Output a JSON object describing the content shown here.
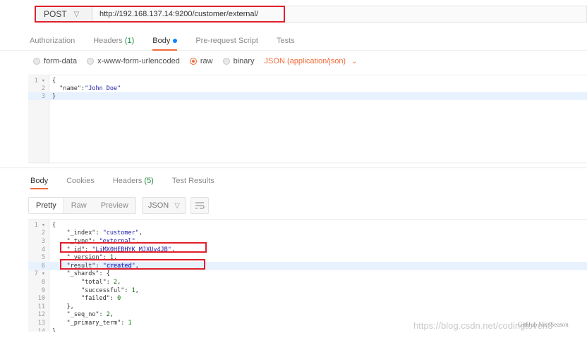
{
  "request": {
    "method": "POST",
    "url": "http://192.168.137.14:9200/customer/external/"
  },
  "request_tabs": [
    {
      "label": "Authorization"
    },
    {
      "label": "Headers",
      "count": "(1)"
    },
    {
      "label": "Body"
    },
    {
      "label": "Pre-request Script"
    },
    {
      "label": "Tests"
    }
  ],
  "body_modes": {
    "form_data": "form-data",
    "urlencoded": "x-www-form-urlencoded",
    "raw": "raw",
    "binary": "binary",
    "content_type": "JSON (application/json)"
  },
  "request_body": {
    "lines": [
      {
        "n": "1 ▾",
        "text": "{"
      },
      {
        "n": "2",
        "text": "  \"name\":\"John Doe\""
      },
      {
        "n": "3",
        "text": "}"
      }
    ]
  },
  "response_tabs": [
    {
      "label": "Body"
    },
    {
      "label": "Cookies"
    },
    {
      "label": "Headers",
      "count": "(5)"
    },
    {
      "label": "Test Results"
    }
  ],
  "response_toolbar": {
    "pretty": "Pretty",
    "raw": "Raw",
    "preview": "Preview",
    "format": "JSON"
  },
  "response_body": {
    "lines": [
      {
        "n": "1 ▾",
        "text": "{"
      },
      {
        "n": "2",
        "text": "    \"_index\": \"customer\","
      },
      {
        "n": "3",
        "text": "    \"_type\": \"external\","
      },
      {
        "n": "4",
        "text": "    \"_id\": \"LiMX0HEBHYK_MJXUv4JB\","
      },
      {
        "n": "5",
        "text": "    \"_version\": 1,"
      },
      {
        "n": "6",
        "text": "    \"result\": \"created\","
      },
      {
        "n": "7 ▾",
        "text": "    \"_shards\": {"
      },
      {
        "n": "8",
        "text": "        \"total\": 2,"
      },
      {
        "n": "9",
        "text": "        \"successful\": 1,"
      },
      {
        "n": "10",
        "text": "        \"failed\": 0"
      },
      {
        "n": "11",
        "text": "    },"
      },
      {
        "n": "12",
        "text": "    \"_seq_no\": 2,"
      },
      {
        "n": "13",
        "text": "    \"_primary_term\": 1"
      },
      {
        "n": "14",
        "text": "}"
      }
    ]
  },
  "watermark": {
    "url": "https://blog.csdn.net/codingtoven3",
    "tag": "GitHub NiceSeason"
  },
  "colors": {
    "accent": "#f26b3a",
    "highlight_box": "#e0202c"
  }
}
